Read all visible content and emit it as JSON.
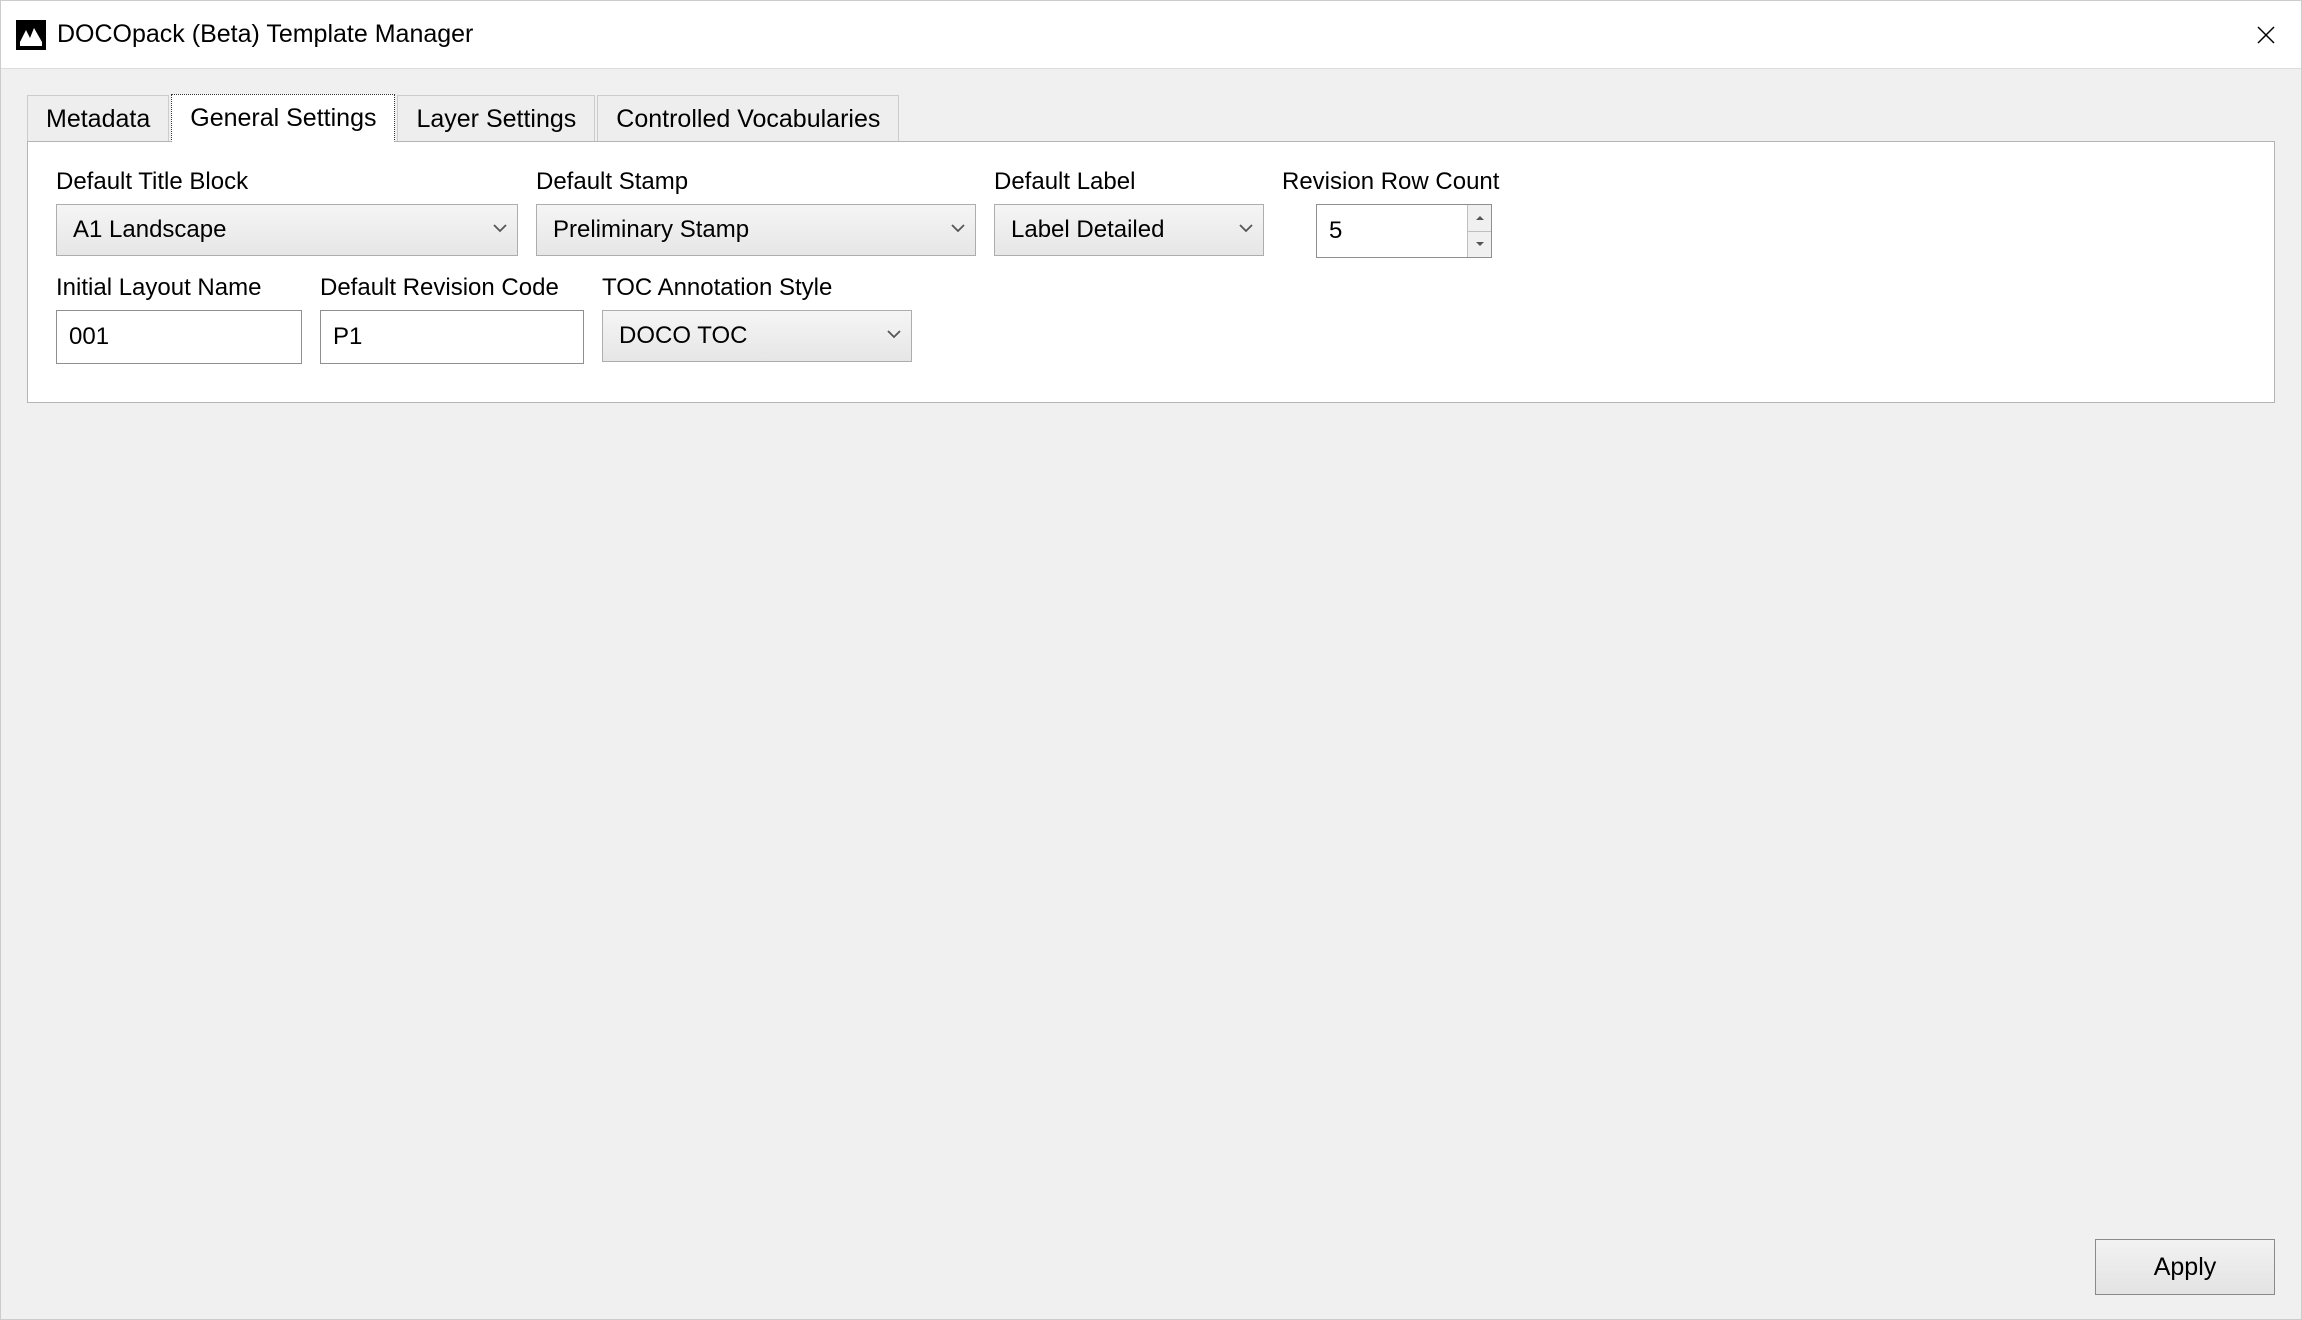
{
  "window": {
    "title": "DOCOpack (Beta) Template Manager"
  },
  "tabs": {
    "metadata": "Metadata",
    "general_settings": "General Settings",
    "layer_settings": "Layer Settings",
    "controlled_vocabularies": "Controlled Vocabularies"
  },
  "fields": {
    "default_title_block": {
      "label": "Default Title Block",
      "value": "A1 Landscape"
    },
    "default_stamp": {
      "label": "Default Stamp",
      "value": "Preliminary Stamp"
    },
    "default_label": {
      "label": "Default Label",
      "value": "Label Detailed"
    },
    "revision_row_count": {
      "label": "Revision Row Count",
      "value": "5"
    },
    "initial_layout_name": {
      "label": "Initial Layout Name",
      "value": "001"
    },
    "default_revision_code": {
      "label": "Default Revision Code",
      "value": "P1"
    },
    "toc_annotation_style": {
      "label": "TOC Annotation Style",
      "value": "DOCO TOC"
    }
  },
  "buttons": {
    "apply": "Apply"
  }
}
